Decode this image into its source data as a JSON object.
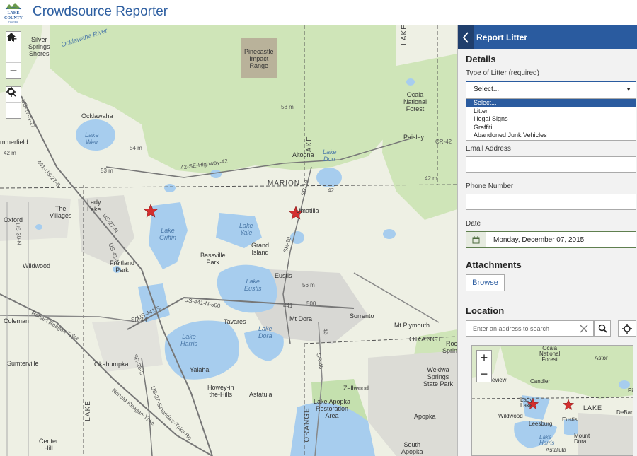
{
  "header": {
    "logo_text": [
      "LAKE",
      "COUNTY",
      "FLORIDA"
    ],
    "title": "Crowdsource Reporter"
  },
  "map": {
    "controls": {
      "zoom_in": "+",
      "home_icon": "home-icon",
      "zoom_out": "−",
      "locate_icon": "locate-icon",
      "search_icon": "search-icon"
    },
    "labels": {
      "silver_springs": "Silver\nSprings\nShores",
      "pinecastle": "Pinecastle\nImpact\nRange",
      "ocklawaha": "Ocklawaha",
      "summerfield": "mmerfield",
      "lake_weir": "Lake\nWeir",
      "altoona": "Altoona",
      "lake_dorr": "Lake\nDorr",
      "paisley": "Paisley",
      "ocala_nf": "Ocala\nNational\nForest",
      "marion": "MARION",
      "lake_county": "LAKE",
      "the_villages": "The\nVillages",
      "lady_lake": "Lady\nLake",
      "oxford": "Oxford",
      "umatilla": "Umatilla",
      "lake_griffin": "Lake\nGriffin",
      "lake_yale": "Lake\nYale",
      "grand_island": "Grand\nIsland",
      "bassville_park": "Bassville\nPark",
      "fruitland_park": "Fruitland\nPark",
      "wildwood": "Wildwood",
      "eustis": "Eustis",
      "lake_eustis": "Lake\nEustis",
      "coleman": "Coleman",
      "tavares": "Tavares",
      "mt_dora": "Mt Dora",
      "lake_dora": "Lake\nDora",
      "sorrento": "Sorrento",
      "mt_plymouth": "Mt Plymouth",
      "orange": "ORANGE",
      "lake_harris": "Lake\nHarris",
      "sumterville": "Sumterville",
      "okahumpka": "Okahumpka",
      "yalaha": "Yalaha",
      "howey": "Howey-in\nthe-Hills",
      "astatula": "Astatula",
      "zellwood": "Zellwood",
      "lake_apopka": "Lake Apopka\nRestoration\nArea",
      "rock_springs": "Rock\nSprings",
      "wekiwa": "Wekiwa\nSprings\nState Park",
      "center_hill": "Center\nHill",
      "apopka": "Apopka",
      "south_apopka": "South\nApopka",
      "orange_v": "ORANGE",
      "lake_v": "LAKE",
      "lake_v2": "LAKE",
      "lake_top": "LAKE",
      "ocklawaha_river": "Ocklawaha River",
      "m58": "58 m",
      "m54": "54 m",
      "m53": "53 m",
      "m42": "42 m",
      "m42b": "42 m",
      "m56": "56 m",
      "r_441_27": "441-US-27-S",
      "r_us27n": "US-27-N-27",
      "r_42se": "42-SE-Highway-42",
      "r_sr19": "SR-19",
      "r_us441s": "US-441-S",
      "r_us441n": "US-441-N-500",
      "r_sr44": "SR-44",
      "r_441": "441",
      "r_500": "500",
      "r_46": "46",
      "r_sr46": "SR-46",
      "r_ronald": "Ronald Reagan Tpke",
      "r_ronald2": "Ronald-Reagan-Tpke",
      "r_florida": "Florida's-Tpke-Ro",
      "r_sr25": "SR-25-S",
      "r_us27s": "US-27-S",
      "r_us41n": "US-41-N",
      "r_us30": "US-30-N",
      "r_cr42": "CR-42",
      "r_42": "42",
      "r_sr19b": "SR-19",
      "r_us27n2": "US-27-N"
    }
  },
  "panel": {
    "back_icon": "chevron-left-icon",
    "title": "Report Litter",
    "details_title": "Details",
    "type_label": "Type of Litter (required)",
    "type_value": "Select...",
    "type_options": [
      "Select...",
      "Litter",
      "Illegal Signs",
      "Graffiti",
      "Abandoned Junk Vehicles"
    ],
    "email_label": "Email Address",
    "email_value": "",
    "phone_label": "Phone Number",
    "phone_value": "",
    "date_label": "Date",
    "date_icon": "calendar-icon",
    "date_value": "Monday, December 07, 2015",
    "attachments_title": "Attachments",
    "browse_label": "Browse",
    "location_title": "Location",
    "search_placeholder": "Enter an address to search",
    "clear_icon": "close-icon",
    "search_icon": "search-icon",
    "locate_icon": "locate-icon",
    "minimap": {
      "zoom_in": "+",
      "zoom_out": "−",
      "labels": {
        "ocala_nf": "Ocala\nNational\nForest",
        "astor": "Astor",
        "candler": "Candler",
        "review": "eview",
        "lady_lake": "Lady\nLake",
        "lake": "LAKE",
        "wildwood": "Wildwood",
        "eustis": "Eustis",
        "leesburg": "Leesburg",
        "debar": "DeBar",
        "mount_dora": "Mount\nDora",
        "lake_harris": "Lake\nHarris",
        "astatula": "Astatula",
        "pierson": "Pi"
      }
    }
  },
  "colors": {
    "header_title": "#2e5fa1",
    "panel_header": "#2a5b9f",
    "water": "#a7cdee",
    "forest": "#cfe5b8",
    "urban": "#d8d8d4",
    "star": "#d42e2e"
  }
}
